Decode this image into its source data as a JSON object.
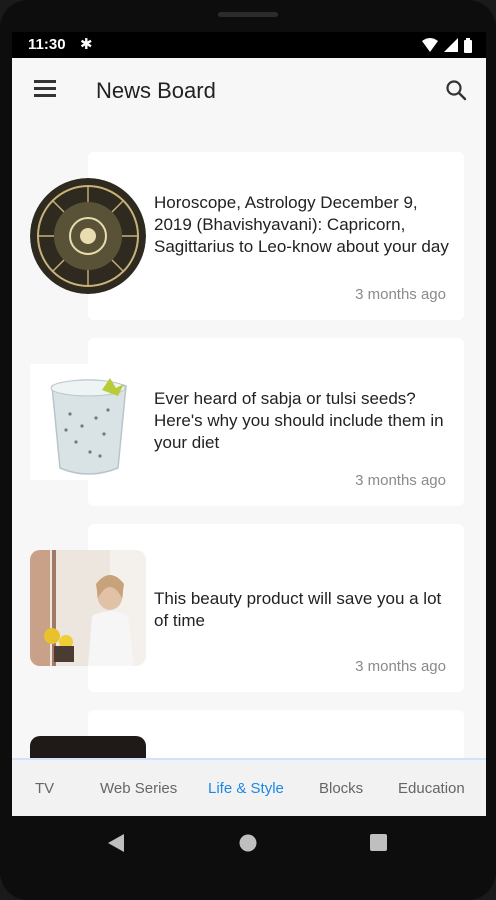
{
  "status_bar": {
    "time": "11:30"
  },
  "app_bar": {
    "title": "News Board"
  },
  "articles": [
    {
      "title": "Horoscope, Astrology December 9, 2019 (Bhavishyavani): Capricorn, Sagittarius to Leo-know about your day",
      "time": "3 months ago"
    },
    {
      "title": "Ever heard of sabja or tulsi seeds? Here's why you should include them in your diet",
      "time": "3 months ago"
    },
    {
      "title": "This beauty product will save you a lot of time",
      "time": "3 months ago"
    }
  ],
  "tabs": [
    {
      "label": "TV",
      "active": false
    },
    {
      "label": "Web Series",
      "active": false
    },
    {
      "label": "Life & Style",
      "active": true
    },
    {
      "label": "Blocks",
      "active": false
    },
    {
      "label": "Education",
      "active": false
    }
  ],
  "colors": {
    "accent": "#1e88e5",
    "screen_bg": "#f7f7f7",
    "card_bg": "#ffffff"
  }
}
